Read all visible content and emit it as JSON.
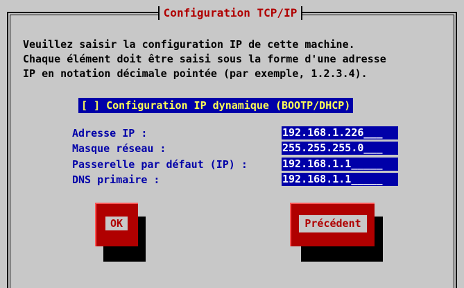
{
  "dialog": {
    "title": "Configuration TCP/IP",
    "intro_lines": [
      "Veuillez saisir la configuration IP de cette machine.",
      "Chaque élément doit être saisi sous la forme d'une adresse",
      "IP en notation décimale pointée (par exemple, 1.2.3.4)."
    ],
    "dhcp_checkbox": "[ ] Configuration IP dynamique (BOOTP/DHCP)",
    "fields": [
      {
        "label": "Adresse IP :",
        "value": "192.168.1.226"
      },
      {
        "label": "Masque réseau :",
        "value": "255.255.255.0"
      },
      {
        "label": "Passerelle par défaut (IP) :",
        "value": "192.168.1.1"
      },
      {
        "label": "DNS primaire :",
        "value": "192.168.1.1"
      }
    ],
    "buttons": {
      "ok": "OK",
      "back": "Précédent"
    }
  },
  "colors": {
    "background": "#c8c8c8",
    "title_red": "#b00000",
    "field_blue": "#0000a8",
    "checkbox_text": "#ffff55",
    "label_blue": "#0000a8"
  }
}
